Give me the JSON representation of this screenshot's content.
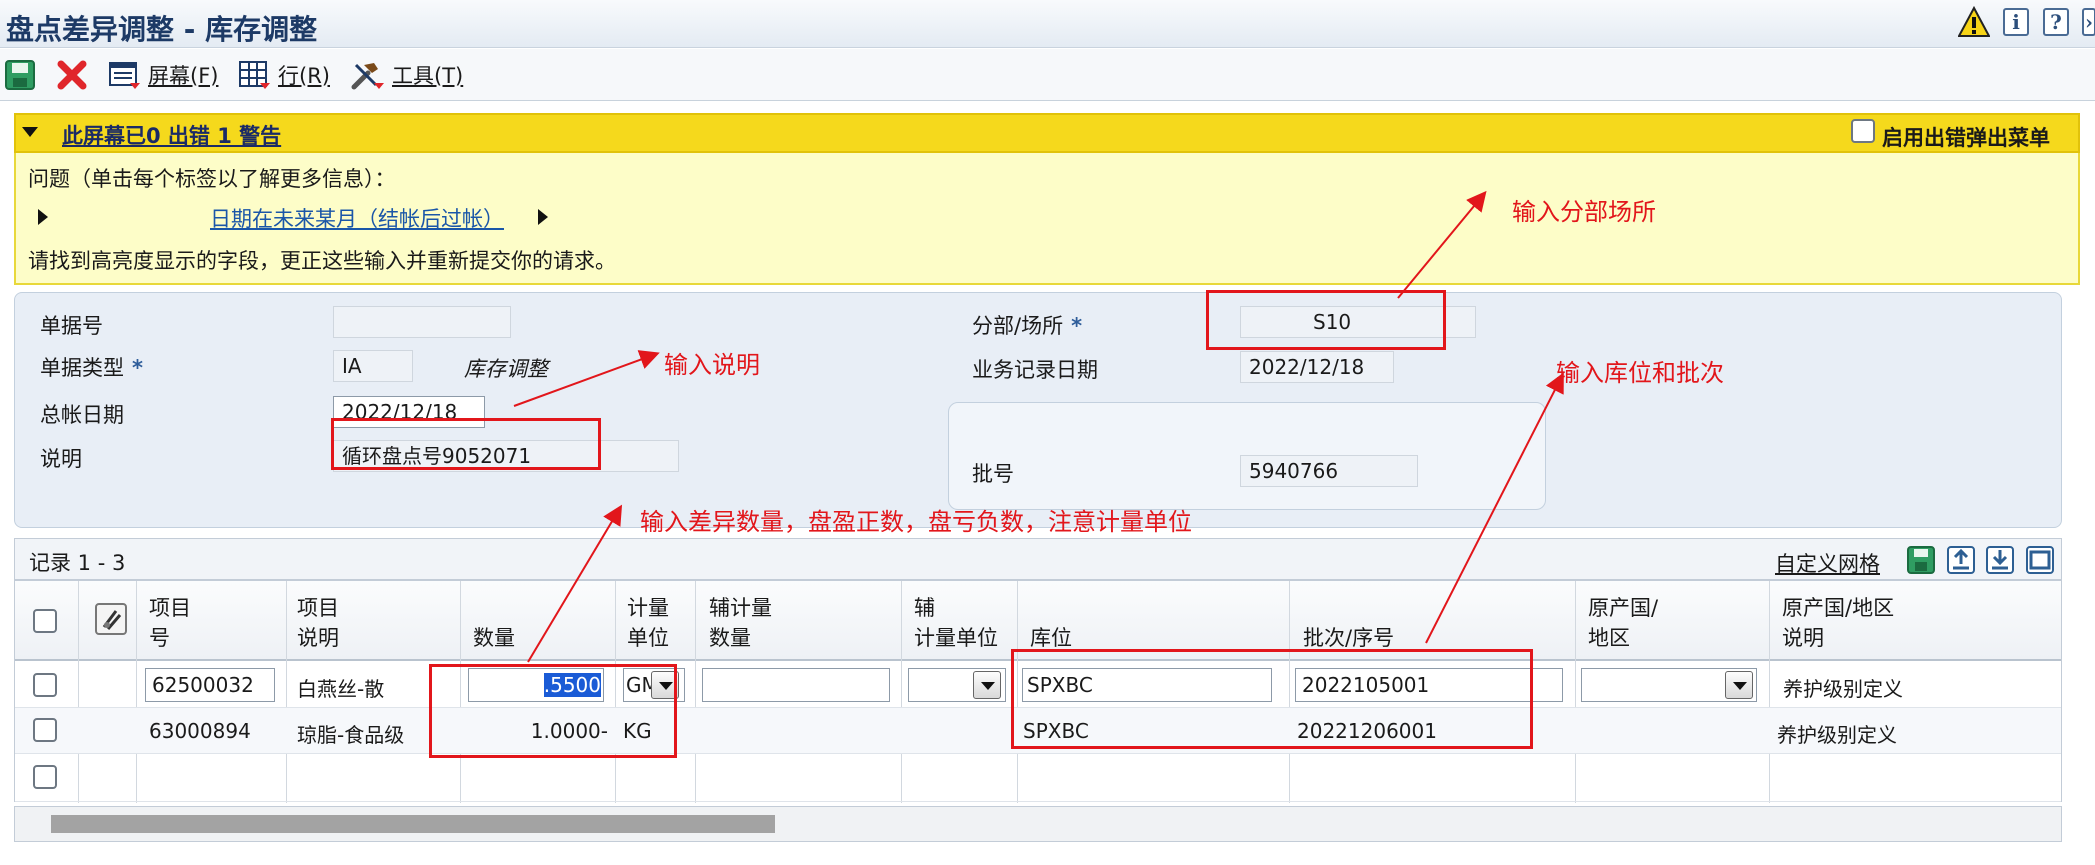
{
  "window": {
    "title": "盘点差异调整 - 库存调整"
  },
  "toolbar": {
    "screen_label": "屏幕(F)",
    "row_label": "行(R)",
    "tools_label": "工具(T)"
  },
  "messages": {
    "summary": "此屏幕已0 出错 1 警告",
    "popup_label": "启用出错弹出菜单",
    "problem_heading": "问题（单击每个标签以了解更多信息）：",
    "warning_link": "日期在未来某月（结帐后过帐）",
    "instruction": "请找到高亮度显示的字段，更正这些输入并重新提交你的请求。"
  },
  "header": {
    "doc_no_label": "单据号",
    "doc_no_value": "",
    "doc_type_label": "单据类型",
    "doc_type_value": "IA",
    "doc_type_desc": "库存调整",
    "gl_date_label": "总帐日期",
    "gl_date_value": "2022/12/18",
    "explanation_label": "说明",
    "explanation_value": "循环盘点号9052071",
    "branch_label": "分部/场所",
    "branch_value": "S10",
    "trans_date_label": "业务记录日期",
    "trans_date_value": "2022/12/18",
    "lot_label": "批号",
    "lot_value": "5940766"
  },
  "grid": {
    "records_label": "记录 1 - 3",
    "customize_label": "自定义网格",
    "columns": [
      {
        "line1": "项目",
        "line2": "号"
      },
      {
        "line1": "项目",
        "line2": "说明"
      },
      {
        "line1": "",
        "line2": "数量"
      },
      {
        "line1": "计量",
        "line2": "单位"
      },
      {
        "line1": "辅计量",
        "line2": "数量"
      },
      {
        "line1": "辅",
        "line2": "计量单位"
      },
      {
        "line1": "",
        "line2": "库位"
      },
      {
        "line1": "",
        "line2": "批次/序号"
      },
      {
        "line1": "原产国/",
        "line2": "地区"
      },
      {
        "line1": "原产国/地区",
        "line2": "说明"
      }
    ],
    "rows": [
      {
        "item": "62500032",
        "desc": "白燕丝-散",
        "qty": ".5500",
        "uom": "GM",
        "sec_qty": "",
        "sec_uom": "",
        "location": "SPXBC",
        "lot": "2022105001",
        "origin": "",
        "origin_desc": "养护级别定义"
      },
      {
        "item": "63000894",
        "desc": "琼脂-食品级",
        "qty": "1.0000-",
        "uom": "KG",
        "sec_qty": "",
        "sec_uom": "",
        "location": "SPXBC",
        "lot": "20221206001",
        "origin": "",
        "origin_desc": "养护级别定义"
      }
    ]
  },
  "annotations": {
    "branch": "输入分部场所",
    "explanation": "输入说明",
    "location_lot": "输入库位和批次",
    "quantity": "输入差异数量，盘盈正数，盘亏负数，注意计量单位"
  },
  "colors": {
    "accent": "#1d3a66",
    "warning_bar": "#f5d91c",
    "annotation": "#e2161b"
  }
}
